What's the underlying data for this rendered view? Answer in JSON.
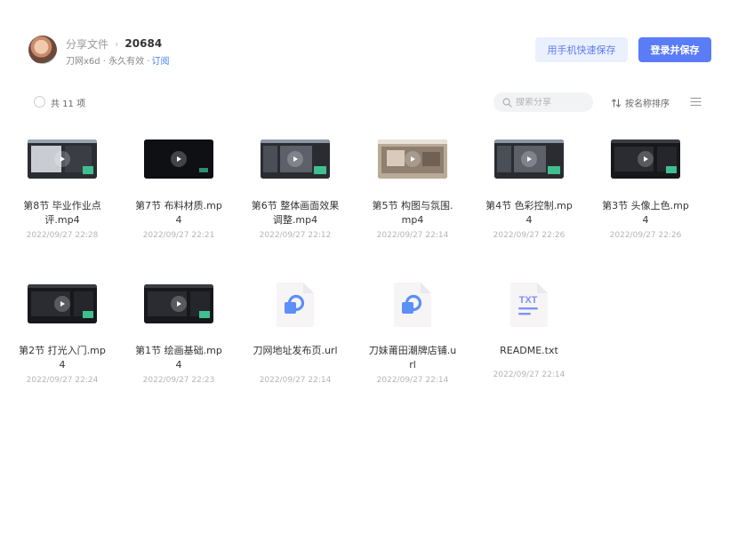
{
  "header": {
    "breadcrumb_root": "分享文件",
    "breadcrumb_sep": "›",
    "breadcrumb_current": "20684",
    "share_info": "刀网x6d · 永久有效 ·",
    "subscribe_label": "订阅"
  },
  "actions": {
    "mobile_save_label": "用手机快速保存",
    "login_save_label": "登录并保存"
  },
  "toolbar": {
    "count_label": "共 11 项",
    "search_placeholder": "搜索分享",
    "sort_label": "按名称排序"
  },
  "files": [
    {
      "name": "第8节 毕业作业点评.mp4",
      "date": "2022/09/27 22:28",
      "type": "video",
      "thumb": "editor-light"
    },
    {
      "name": "第7节 布料材质.mp4",
      "date": "2022/09/27 22:21",
      "type": "video",
      "thumb": "dark"
    },
    {
      "name": "第6节 整体画面效果调整.mp4",
      "date": "2022/09/27 22:12",
      "type": "video",
      "thumb": "editor"
    },
    {
      "name": "第5节 构图与氛围.mp4",
      "date": "2022/09/27 22:14",
      "type": "video",
      "thumb": "photo"
    },
    {
      "name": "第4节 色彩控制.mp4",
      "date": "2022/09/27 22:26",
      "type": "video",
      "thumb": "editor"
    },
    {
      "name": "第3节 头像上色.mp4",
      "date": "2022/09/27 22:26",
      "type": "video",
      "thumb": "dark-editor"
    },
    {
      "name": "第2节 打光入门.mp4",
      "date": "2022/09/27 22:24",
      "type": "video",
      "thumb": "dark-editor"
    },
    {
      "name": "第1节 绘画基础.mp4",
      "date": "2022/09/27 22:23",
      "type": "video",
      "thumb": "dark-editor"
    },
    {
      "name": "刀网地址发布页.url",
      "date": "2022/09/27 22:14",
      "type": "url"
    },
    {
      "name": "刀妹莆田潮牌店铺.url",
      "date": "2022/09/27 22:14",
      "type": "url"
    },
    {
      "name": "README.txt",
      "date": "2022/09/27 22:14",
      "type": "txt",
      "icon_text": "TXT"
    }
  ],
  "colors": {
    "primary": "#5b7cf7",
    "primary_light": "#eaf0fe",
    "link": "#3f7df6",
    "url_icon": "#5b8ff9",
    "txt_icon": "#7b93f5"
  },
  "icons": {
    "search": "search-icon",
    "sort": "sort-icon",
    "list_view": "list-view-icon",
    "play": "play-icon",
    "link_file": "link-file-icon",
    "txt_file": "txt-file-icon"
  }
}
